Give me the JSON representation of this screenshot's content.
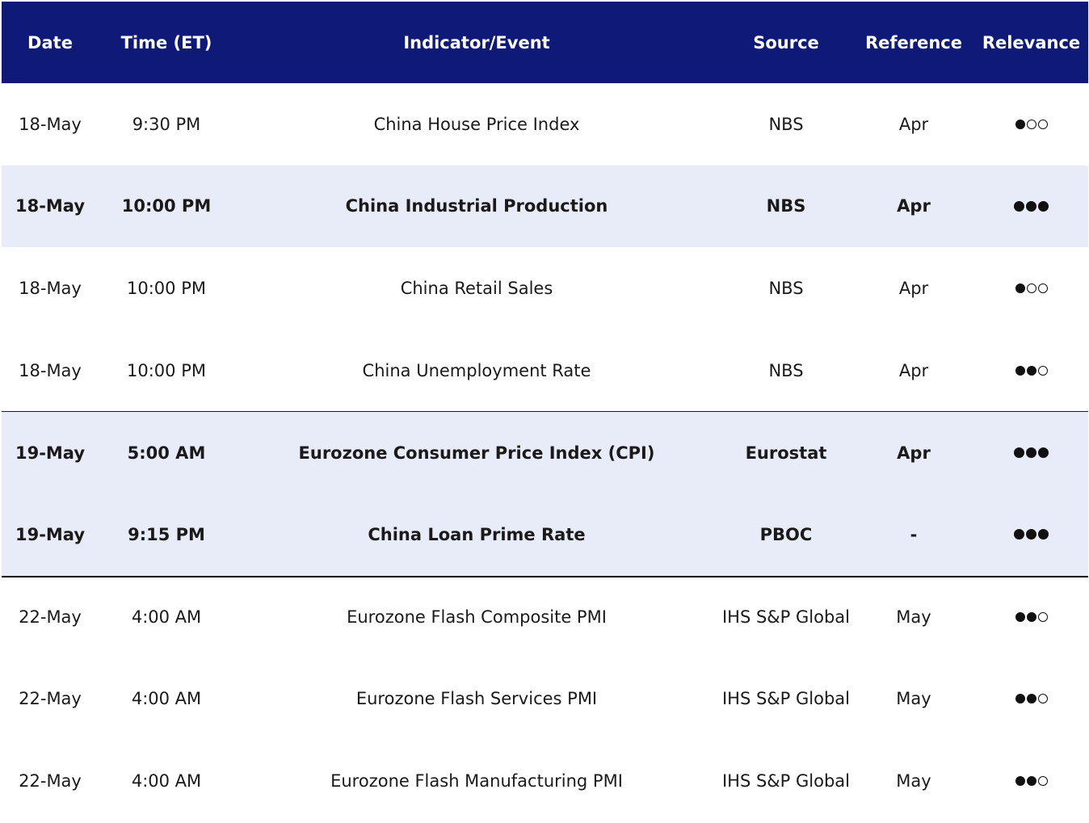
{
  "header": {
    "date": "Date",
    "time": "Time (ET)",
    "indicator": "Indicator/Event",
    "source": "Source",
    "reference": "Reference",
    "relevance": "Relevance"
  },
  "rows": [
    {
      "date": "18-May",
      "time": "9:30 PM",
      "indicator": "China House Price Index",
      "source": "NBS",
      "reference": "Apr",
      "relevance": 1,
      "relevance_symbol": "●○○",
      "bold": false,
      "shaded": false
    },
    {
      "date": "18-May",
      "time": "10:00 PM",
      "indicator": "China Industrial Production",
      "source": "NBS",
      "reference": "Apr",
      "relevance": 3,
      "relevance_symbol": "●●●",
      "bold": true,
      "shaded": true
    },
    {
      "date": "18-May",
      "time": "10:00 PM",
      "indicator": "China Retail Sales",
      "source": "NBS",
      "reference": "Apr",
      "relevance": 1,
      "relevance_symbol": "●○○",
      "bold": false,
      "shaded": false
    },
    {
      "date": "18-May",
      "time": "10:00 PM",
      "indicator": "China Unemployment Rate",
      "source": "NBS",
      "reference": "Apr",
      "relevance": 2,
      "relevance_symbol": "●●○",
      "bold": false,
      "shaded": false
    },
    {
      "date": "19-May",
      "time": "5:00 AM",
      "indicator": "Eurozone Consumer Price Index (CPI)",
      "source": "Eurostat",
      "reference": "Apr",
      "relevance": 3,
      "relevance_symbol": "●●●",
      "bold": true,
      "shaded": true
    },
    {
      "date": "19-May",
      "time": "9:15 PM",
      "indicator": "China Loan Prime Rate",
      "source": "PBOC",
      "reference": "-",
      "relevance": 3,
      "relevance_symbol": "●●●",
      "bold": true,
      "shaded": true
    },
    {
      "date": "22-May",
      "time": "4:00 AM",
      "indicator": "Eurozone Flash Composite PMI",
      "source": "IHS S&P Global",
      "reference": "May",
      "relevance": 2,
      "relevance_symbol": "●●○",
      "bold": false,
      "shaded": false
    },
    {
      "date": "22-May",
      "time": "4:00 AM",
      "indicator": "Eurozone Flash Services PMI",
      "source": "IHS S&P Global",
      "reference": "May",
      "relevance": 2,
      "relevance_symbol": "●●○",
      "bold": false,
      "shaded": false
    },
    {
      "date": "22-May",
      "time": "4:00 AM",
      "indicator": "Eurozone Flash Manufacturing PMI",
      "source": "IHS S&P Global",
      "reference": "May",
      "relevance": 2,
      "relevance_symbol": "●●○",
      "bold": false,
      "shaded": false
    }
  ],
  "colors": {
    "header_bg": "#0f1a78",
    "header_text": "#ffffff",
    "shade_bg": "#e8ecf8"
  }
}
